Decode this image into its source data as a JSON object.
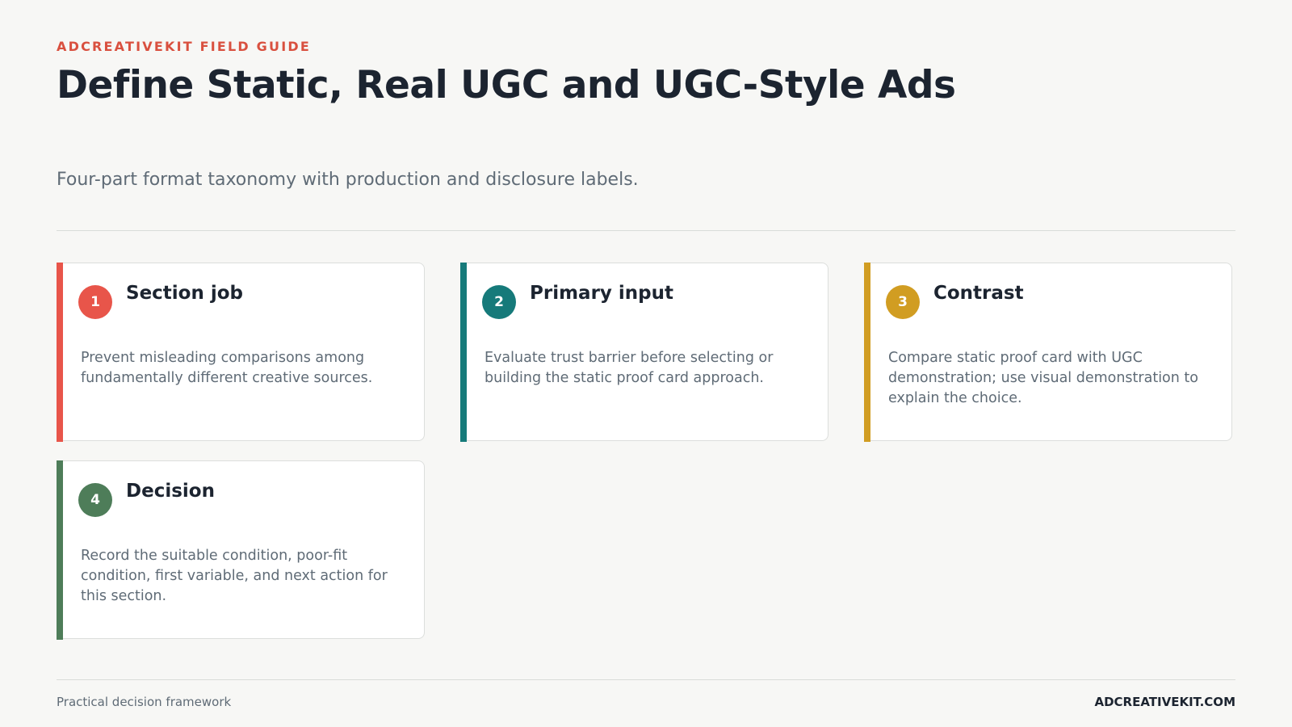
{
  "header": {
    "eyebrow": "ADCREATIVEKIT FIELD GUIDE",
    "title": "Define Static, Real UGC and UGC-Style Ads",
    "subtitle": "Four-part format taxonomy with production and disclosure labels."
  },
  "cards": [
    {
      "number": "1",
      "title": "Section job",
      "body": "Prevent misleading comparisons among fundamentally different creative sources.",
      "accent": "#e8554a"
    },
    {
      "number": "2",
      "title": "Primary input",
      "body": "Evaluate trust barrier before selecting or building the static proof card approach.",
      "accent": "#167a7a"
    },
    {
      "number": "3",
      "title": "Contrast",
      "body": "Compare static proof card with UGC demonstration; use visual demonstration to explain the choice.",
      "accent": "#d19d22"
    },
    {
      "number": "4",
      "title": "Decision",
      "body": "Record the suitable condition, poor-fit condition, first variable, and next action for this section.",
      "accent": "#4e7d59"
    }
  ],
  "footer": {
    "left": "Practical decision framework",
    "right": "ADCREATIVEKIT.COM"
  }
}
